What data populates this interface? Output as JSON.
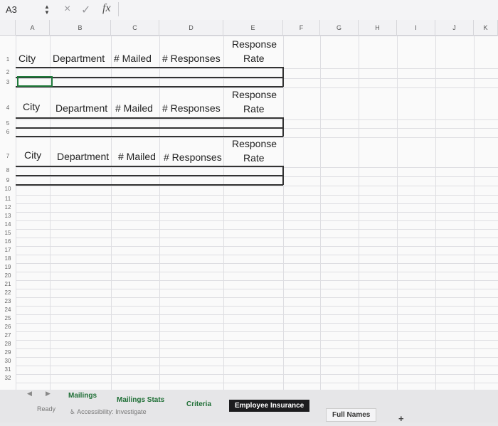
{
  "formula_bar": {
    "name_box": "A3",
    "cancel_icon": "×",
    "confirm_icon": "✓",
    "fx_label": "fx",
    "content": ""
  },
  "columns": [
    "A",
    "B",
    "C",
    "D",
    "E",
    "F",
    "G",
    "H",
    "I",
    "J",
    "K"
  ],
  "rows": [
    "1",
    "2",
    "3",
    "4",
    "5",
    "6",
    "7",
    "8",
    "9",
    "10",
    "11",
    "12",
    "13",
    "14",
    "15",
    "16",
    "17",
    "18",
    "19",
    "20",
    "21",
    "22",
    "23",
    "24",
    "25",
    "26",
    "27",
    "28",
    "29",
    "30",
    "31",
    "32"
  ],
  "tables": [
    {
      "city": "City",
      "department": "Department",
      "mailed": "# Mailed",
      "responses": "# Responses",
      "rate_line1": "Response",
      "rate_line2": "Rate"
    },
    {
      "city": "City",
      "department": "Department",
      "mailed": "# Mailed",
      "responses": "# Responses",
      "rate_line1": "Response",
      "rate_line2": "Rate"
    },
    {
      "city": "City",
      "department": "Department",
      "mailed": "# Mailed",
      "responses": "# Responses",
      "rate_line1": "Response",
      "rate_line2": "Rate"
    }
  ],
  "sheet_tabs": [
    "Mailings",
    "Mailings Stats",
    "Criteria",
    "Employee Insurance",
    "Full Names"
  ],
  "add_sheet": "+",
  "status": {
    "ready": "Ready",
    "accessibility": "Accessibility: Investigate"
  }
}
